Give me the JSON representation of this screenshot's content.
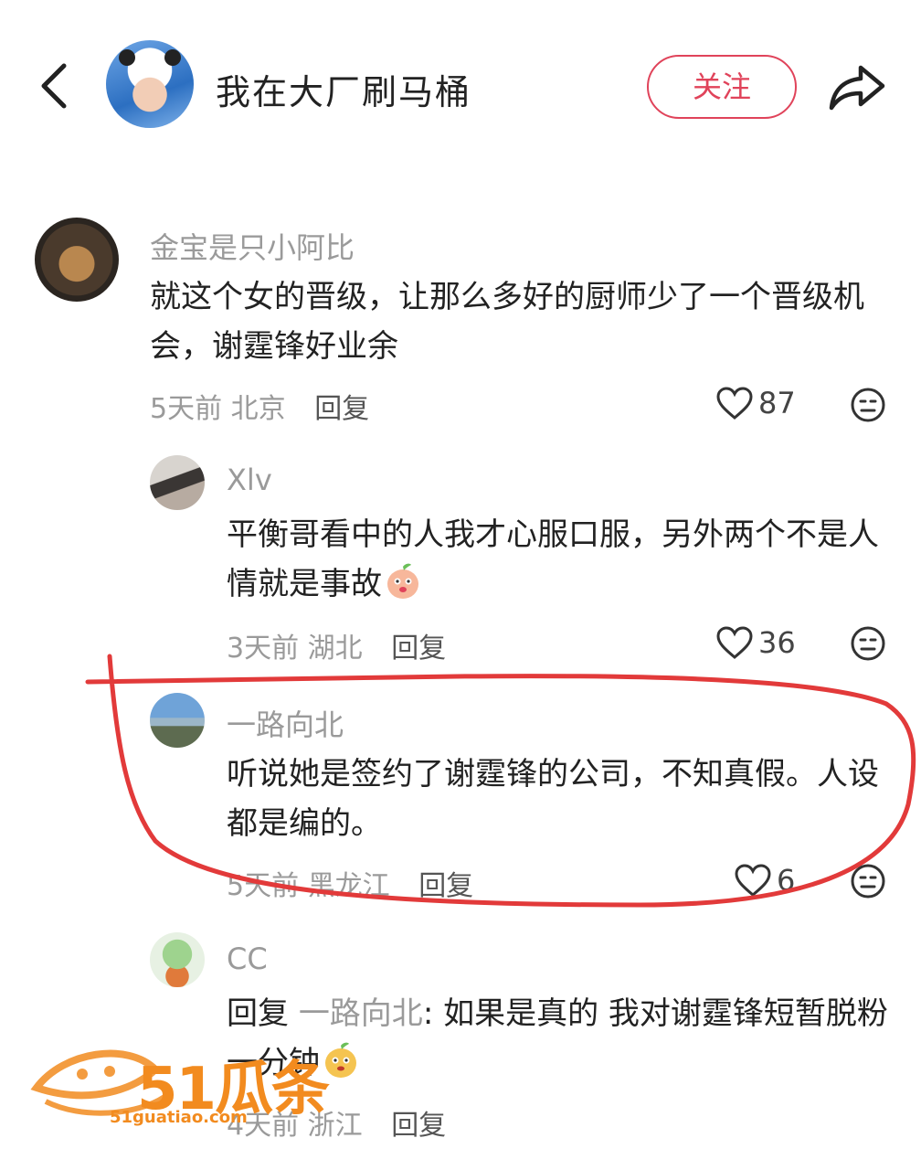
{
  "header": {
    "title": "我在大厂刷马桶",
    "follow_label": "关注"
  },
  "comments": [
    {
      "username": "金宝是只小阿比",
      "text": "就这个女的晋级，让那么多好的厨师少了一个晋级机会，谢霆锋好业余",
      "time": "5天前",
      "location": "北京",
      "reply_label": "回复",
      "likes": "87"
    },
    {
      "username": "Xlv",
      "text": "平衡哥看中的人我才心服口服，另外两个不是人情就是事故",
      "time": "3天前",
      "location": "湖北",
      "reply_label": "回复",
      "likes": "36"
    },
    {
      "username": "一路向北",
      "text": "听说她是签约了谢霆锋的公司，不知真假。人设都是编的。",
      "time": "5天前",
      "location": "黑龙江",
      "reply_label": "回复",
      "likes": "6"
    },
    {
      "username": "CC",
      "reply_prefix": "回复",
      "reply_to": "一路向北",
      "text": ": 如果是真的  我对谢霆锋短暂脱粉一分钟",
      "time": "4天前",
      "location": "浙江",
      "reply_label": "回复"
    }
  ],
  "watermark": {
    "brand": "51瓜条",
    "url": "51guatiao.com"
  },
  "colors": {
    "accent": "#e0435a",
    "annotation": "#e23a3a",
    "watermark": "#f28b1f"
  }
}
